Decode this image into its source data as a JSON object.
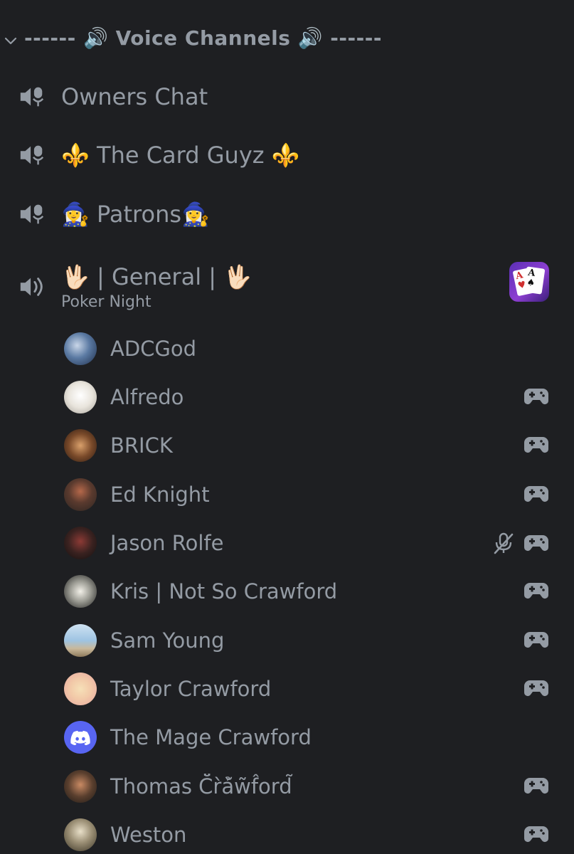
{
  "colors": {
    "background": "#1e1f22",
    "text_muted": "#949ba4",
    "discord_blurple": "#5865f2"
  },
  "category": {
    "label": "------ 🔊 Voice Channels 🔊 ------",
    "expanded": true
  },
  "channels": [
    {
      "name": "Owners Chat",
      "icon": "stage-icon"
    },
    {
      "name": "⚜️ The Card Guyz ⚜️",
      "icon": "stage-icon"
    },
    {
      "name": "🧙‍♀️ Patrons🧙‍♀️",
      "icon": "stage-icon"
    },
    {
      "name": "🖖🏻 | General | 🖖🏻",
      "icon": "speaker-icon",
      "status": "Poker Night",
      "activity_icon": "poker-cards-icon"
    }
  ],
  "members": [
    {
      "name": "ADCGod",
      "avatar": "dragon-avatar",
      "gaming": false,
      "muted": false
    },
    {
      "name": "Alfredo",
      "avatar": "crest-avatar",
      "gaming": true,
      "muted": false
    },
    {
      "name": "BRICK",
      "avatar": "photo-avatar",
      "gaming": true,
      "muted": false
    },
    {
      "name": "Ed Knight",
      "avatar": "photo-avatar",
      "gaming": true,
      "muted": false
    },
    {
      "name": "Jason Rolfe",
      "avatar": "photo-avatar",
      "gaming": true,
      "muted": true
    },
    {
      "name": "Kris | Not So Crawford",
      "avatar": "drawing-avatar",
      "gaming": true,
      "muted": false
    },
    {
      "name": "Sam Young",
      "avatar": "beach-avatar",
      "gaming": true,
      "muted": false
    },
    {
      "name": "Taylor Crawford",
      "avatar": "cartoon-avatar",
      "gaming": true,
      "muted": false
    },
    {
      "name": "The Mage Crawford",
      "avatar": "discord-default-avatar",
      "gaming": false,
      "muted": false
    },
    {
      "name": "Thomas C̆̈r̀ả̆w̃f̂ord̃",
      "avatar": "photo-avatar",
      "gaming": true,
      "muted": false
    },
    {
      "name": "Weston",
      "avatar": "cocktail-avatar",
      "gaming": true,
      "muted": false
    }
  ]
}
